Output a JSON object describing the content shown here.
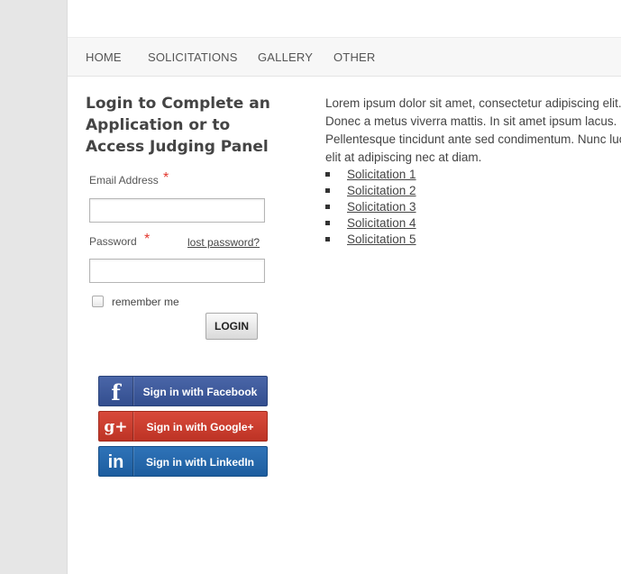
{
  "nav": {
    "items": [
      {
        "label": "HOME"
      },
      {
        "label": "SOLICITATIONS"
      },
      {
        "label": "GALLERY"
      },
      {
        "label": "OTHER"
      }
    ]
  },
  "login": {
    "title": "Login to Complete an Application or to Access Judging Panel",
    "email_label": "Email Address",
    "password_label": "Password",
    "required_mark": "*",
    "lost_password": "lost password?",
    "email_value": "",
    "password_value": "",
    "remember_label": "remember me",
    "remember_checked": false,
    "submit_label": "LOGIN"
  },
  "social": {
    "facebook": {
      "label": "Sign in with Facebook",
      "icon": "facebook-icon",
      "glyph": "f",
      "color": "#3b5998"
    },
    "google": {
      "label": "Sign in with Google+",
      "icon": "google-plus-icon",
      "glyph": "g+",
      "color": "#c6392b"
    },
    "linkedin": {
      "label": "Sign in with LinkedIn",
      "icon": "linkedin-icon",
      "glyph": "in",
      "color": "#2767ab"
    }
  },
  "content": {
    "paragraph": "Lorem ipsum dolor sit amet, consectetur adipiscing elit. Donec a metus viverra mattis. In sit amet ipsum lacus. Pellentesque tincidunt ante sed condimentum. Nunc luctus elit at adipiscing nec at diam.",
    "solicitations": [
      {
        "label": "Solicitation 1"
      },
      {
        "label": "Solicitation 2"
      },
      {
        "label": "Solicitation 3"
      },
      {
        "label": "Solicitation 4"
      },
      {
        "label": "Solicitation 5"
      }
    ]
  },
  "colors": {
    "required": "#e3372e",
    "text": "#444444",
    "nav_bg": "#f7f7f7"
  }
}
